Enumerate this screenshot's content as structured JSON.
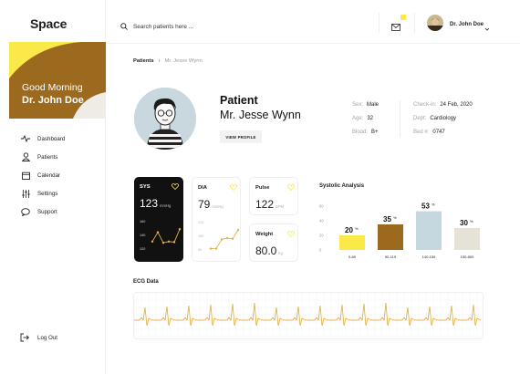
{
  "app": {
    "logo": "Space"
  },
  "greeting": {
    "line1": "Good Morning",
    "name": "Dr. John Doe"
  },
  "sidebar": {
    "items": [
      {
        "label": "Dashboard",
        "icon": "pulse-icon"
      },
      {
        "label": "Patients",
        "icon": "user-icon"
      },
      {
        "label": "Calendar",
        "icon": "calendar-icon"
      },
      {
        "label": "Settings",
        "icon": "sliders-icon"
      },
      {
        "label": "Support",
        "icon": "chat-icon"
      }
    ],
    "logout": "Log Out"
  },
  "header": {
    "search_placeholder": "Search patients here ...",
    "user_name": "Dr. John Doe"
  },
  "breadcrumb": {
    "root": "Patients",
    "current": "Mr. Jesse Wynn"
  },
  "patient": {
    "title": "Patient",
    "name": "Mr. Jesse Wynn",
    "view_profile": "VIEW PROFILE",
    "info": {
      "sex_label": "Sex:",
      "sex": "Male",
      "age_label": "Age:",
      "age": "32",
      "blood_label": "Blood:",
      "blood": "B+",
      "checkin_label": "Check-in:",
      "checkin": "24 Feb, 2020",
      "dept_label": "Dept:",
      "dept": "Cardiology",
      "bed_label": "Bed #:",
      "bed": "0747"
    }
  },
  "vitals": {
    "sys": {
      "label": "SYS",
      "value": "123",
      "unit": "mmHg",
      "axis": [
        "160",
        "140",
        "120"
      ],
      "trend": [
        130,
        145,
        128,
        130,
        129,
        150
      ]
    },
    "dia": {
      "label": "DIA",
      "value": "79",
      "unit": "mmHg",
      "axis": [
        "120",
        "100",
        "80"
      ],
      "trend": [
        80,
        80,
        95,
        97,
        96,
        110
      ]
    },
    "pulse": {
      "label": "Pulse",
      "value": "122",
      "unit": "BPM"
    },
    "weight": {
      "label": "Weight",
      "value": "80.0",
      "unit": "kg"
    }
  },
  "colors": {
    "yellow": "#fbe94a",
    "brown": "#9c6a1e",
    "blue": "#c6d8df",
    "beige": "#e7e2d7",
    "ecg": "#e3b24a"
  },
  "chart_data": {
    "type": "bar",
    "title": "Systolic Analysis",
    "categories": [
      "0-89",
      "90-119",
      "140-159",
      "150-800"
    ],
    "values": [
      20,
      35,
      53,
      30
    ],
    "value_labels": [
      "20",
      "35",
      "53",
      "30"
    ],
    "unit_suffix": "%",
    "yticks": [
      "60",
      "40",
      "20",
      "0"
    ],
    "ylim": [
      0,
      60
    ],
    "colors": [
      "#fbe94a",
      "#9c6a1e",
      "#c6d8df",
      "#e7e2d7"
    ]
  },
  "ecg": {
    "title": "ECG Data"
  }
}
